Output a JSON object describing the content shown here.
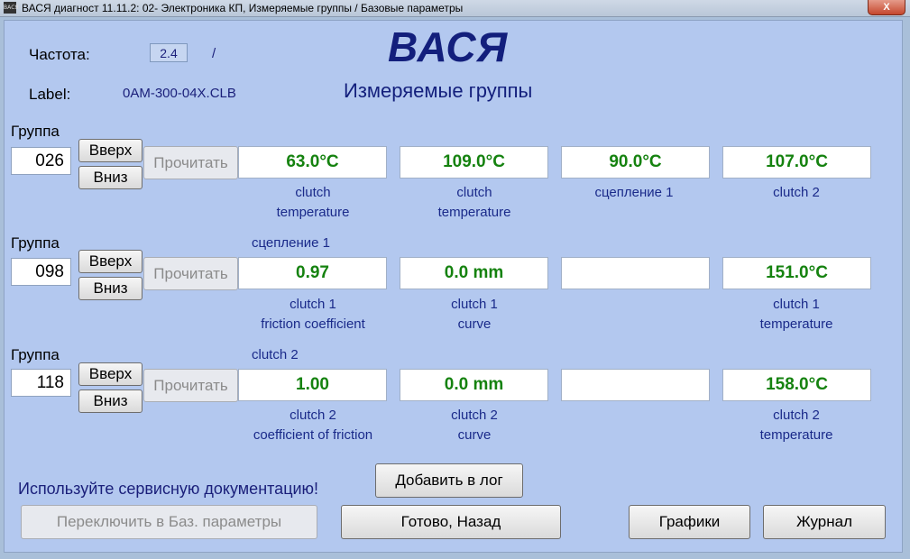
{
  "window": {
    "title": "ВАСЯ диагност 11.11.2: 02- Электроника КП,  Измеряемые группы / Базовые параметры",
    "app_icon": "ВАСЯ",
    "close_glyph": "X"
  },
  "header": {
    "freq_label": "Частота:",
    "freq_value": "2.4",
    "freq_sep": "/",
    "label_label": "Label:",
    "label_value": "0AM-300-04X.CLB",
    "logo": "ВАСЯ",
    "subtitle": "Измеряемые группы"
  },
  "groups": [
    {
      "label": "Группа",
      "number": "026",
      "up": "Вверх",
      "down": "Вниз",
      "read": "Прочитать",
      "title": "",
      "fields": [
        {
          "value": "63.0°C",
          "desc1": "clutch",
          "desc2": "temperature"
        },
        {
          "value": "109.0°C",
          "desc1": "clutch",
          "desc2": "temperature"
        },
        {
          "value": "90.0°C",
          "desc1": "сцепление 1",
          "desc2": ""
        },
        {
          "value": "107.0°C",
          "desc1": "clutch 2",
          "desc2": ""
        }
      ]
    },
    {
      "label": "Группа",
      "number": "098",
      "up": "Вверх",
      "down": "Вниз",
      "read": "Прочитать",
      "title": "сцепление 1",
      "fields": [
        {
          "value": "0.97",
          "desc1": "clutch 1",
          "desc2": "friction coefficient"
        },
        {
          "value": "0.0 mm",
          "desc1": "clutch 1",
          "desc2": "curve"
        },
        {
          "value": "",
          "desc1": "",
          "desc2": ""
        },
        {
          "value": "151.0°C",
          "desc1": "clutch 1",
          "desc2": "temperature"
        }
      ]
    },
    {
      "label": "Группа",
      "number": "118",
      "up": "Вверх",
      "down": "Вниз",
      "read": "Прочитать",
      "title": "clutch 2",
      "fields": [
        {
          "value": "1.00",
          "desc1": "clutch 2",
          "desc2": "coefficient of friction"
        },
        {
          "value": "0.0 mm",
          "desc1": "clutch 2",
          "desc2": "curve"
        },
        {
          "value": "",
          "desc1": "",
          "desc2": ""
        },
        {
          "value": "158.0°C",
          "desc1": "clutch 2",
          "desc2": "temperature"
        }
      ]
    }
  ],
  "footer": {
    "notice": "Используйте сервисную документацию!",
    "add_log": "Добавить в лог",
    "switch_basic": "Переключить в Баз. параметры",
    "done_back": "Готово, Назад",
    "graphs": "Графики",
    "journal": "Журнал"
  },
  "colors": {
    "value_text": "#15820f",
    "logo": "#131f7c",
    "client_bg": "#b3c8ef"
  }
}
